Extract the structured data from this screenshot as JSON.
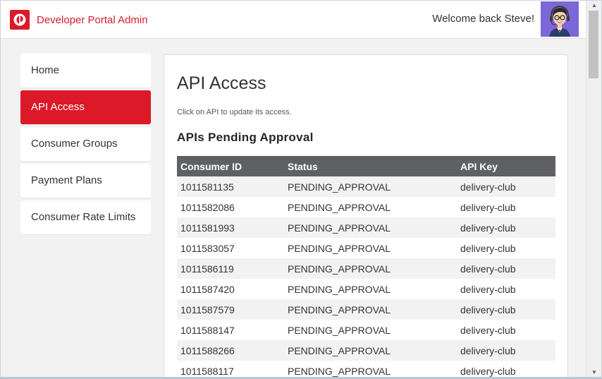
{
  "header": {
    "app_title": "Developer Portal Admin",
    "welcome_text": "Welcome back Steve!"
  },
  "sidebar": {
    "items": [
      {
        "label": "Home",
        "active": false
      },
      {
        "label": "API Access",
        "active": true
      },
      {
        "label": "Consumer Groups",
        "active": false
      },
      {
        "label": "Payment Plans",
        "active": false
      },
      {
        "label": "Consumer Rate Limits",
        "active": false
      }
    ]
  },
  "main": {
    "title": "API Access",
    "subtitle": "Click on API to update its access.",
    "section_title": "APIs Pending Approval",
    "table": {
      "headers": [
        "Consumer ID",
        "Status",
        "API Key"
      ],
      "rows": [
        [
          "1011581135",
          "PENDING_APPROVAL",
          "delivery-club"
        ],
        [
          "1011582086",
          "PENDING_APPROVAL",
          "delivery-club"
        ],
        [
          "1011581993",
          "PENDING_APPROVAL",
          "delivery-club"
        ],
        [
          "1011583057",
          "PENDING_APPROVAL",
          "delivery-club"
        ],
        [
          "1011586119",
          "PENDING_APPROVAL",
          "delivery-club"
        ],
        [
          "1011587420",
          "PENDING_APPROVAL",
          "delivery-club"
        ],
        [
          "1011587579",
          "PENDING_APPROVAL",
          "delivery-club"
        ],
        [
          "1011588147",
          "PENDING_APPROVAL",
          "delivery-club"
        ],
        [
          "1011588266",
          "PENDING_APPROVAL",
          "delivery-club"
        ],
        [
          "1011588117",
          "PENDING_APPROVAL",
          "delivery-club"
        ]
      ]
    }
  },
  "icons": {
    "logo": "brand-logo-icon",
    "avatar": "user-avatar-icon",
    "scroll_up": "chevron-up-icon",
    "scroll_down": "chevron-down-icon"
  },
  "colors": {
    "brand_red": "#dc1928",
    "table_header": "#5f6063",
    "page_background": "#f2f2f2",
    "avatar_background": "#7c67d8"
  }
}
